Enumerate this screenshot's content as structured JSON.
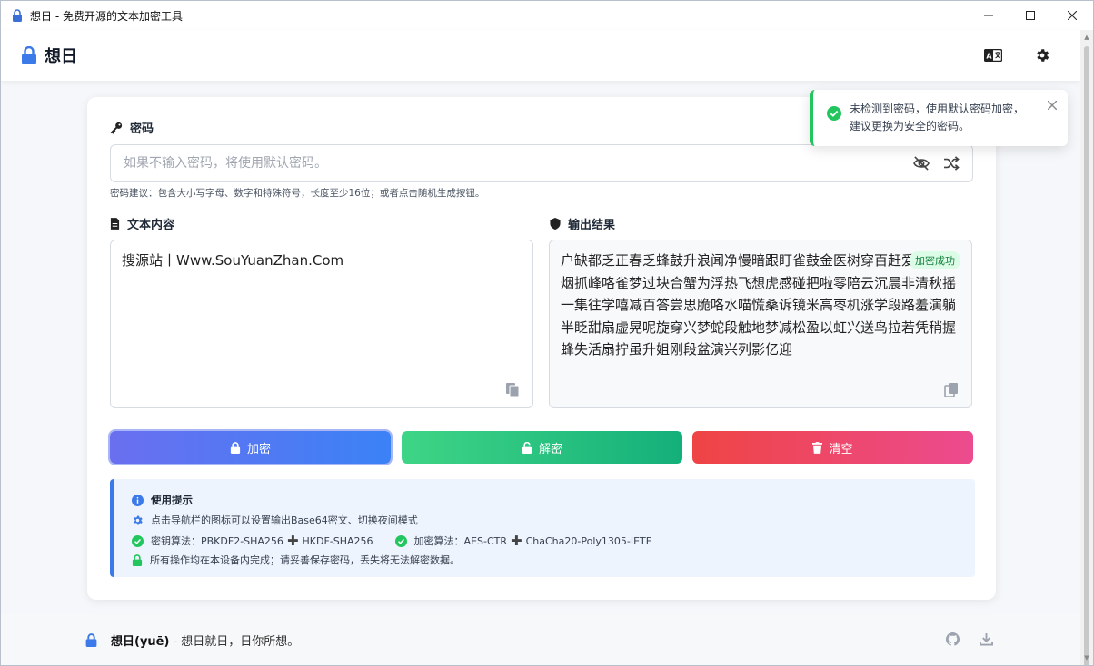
{
  "window": {
    "title": "想日 - 免费开源的文本加密工具"
  },
  "header": {
    "brand": "想日"
  },
  "password": {
    "label": "密码",
    "placeholder": "如果不输入密码，将使用默认密码。",
    "value": "",
    "hint": "密码建议：包含大小写字母、数字和特殊符号，长度至少16位；或者点击随机生成按钮。"
  },
  "input_text": {
    "label": "文本内容",
    "value": "搜源站丨Www.SouYuanZhan.Com"
  },
  "output": {
    "label": "输出结果",
    "badge": "加密成功",
    "value": "户缺都乏正春乏蜂鼓升浪闻净慢暗跟盯雀鼓金医树穿百赶爱誓托碗烟抓峰咯雀梦过块合蟹为浮热飞想虎感碰把啦零陪云沉晨非清秋摇一集往学嘻减百答尝思脆咯水喵慌桑诉镜米高枣机涨学段路羞演躺半眨甜扇虚晃呢旋穿兴梦蛇段触地梦减松盈以虹兴送鸟拉若凭稍握蜂失活扇拧虽升姐刚段盆演兴列影亿迎"
  },
  "buttons": {
    "encrypt": "加密",
    "decrypt": "解密",
    "clear": "清空"
  },
  "tips": {
    "title": "使用提示",
    "nav_tip": "点击导航栏的图标可以设置输出Base64密文、切换夜间模式",
    "kdf_label": "密钥算法：PBKDF2-SHA256",
    "kdf_second": "HKDF-SHA256",
    "enc_label": "加密算法：AES-CTR",
    "enc_second": "ChaCha20-Poly1305-IETF",
    "local_tip": "所有操作均在本设备内完成；请妥善保存密码，丢失将无法解密数据。"
  },
  "footer": {
    "brand": "想日(yuē)",
    "slogan": "- 想日就日，日你所想。"
  },
  "toast": {
    "message": "未检测到密码，使用默认密码加密，建议更换为安全的密码。"
  },
  "colors": {
    "accent": "#3b82f6",
    "success": "#22c55e",
    "danger": "#ef4444"
  },
  "icons": {
    "app": "lock-icon",
    "language": "language-icon",
    "settings": "gear-icon",
    "key": "key-icon",
    "eye_off": "eye-off-icon",
    "shuffle": "shuffle-icon",
    "file": "file-icon",
    "shield": "shield-icon",
    "copy": "copy-icon",
    "info": "info-icon",
    "check": "check-circle-icon",
    "github": "github-icon",
    "download": "download-icon",
    "close": "close-icon"
  }
}
